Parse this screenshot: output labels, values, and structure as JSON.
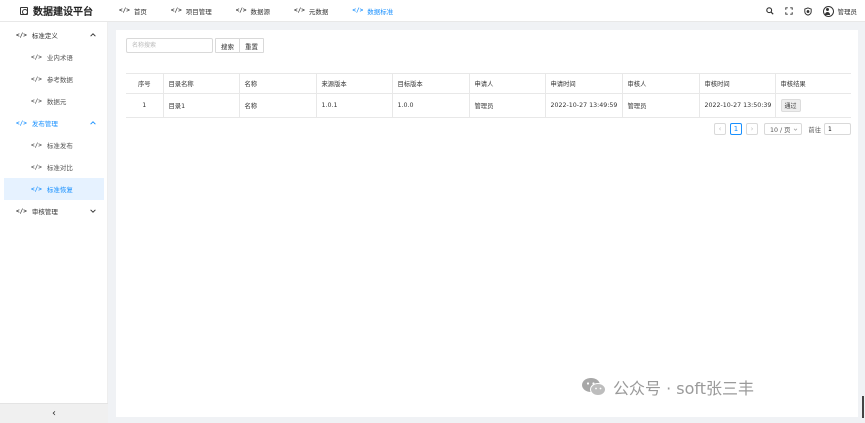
{
  "app": {
    "title": "数据建设平台"
  },
  "nav": {
    "code_glyph": "</>",
    "items": [
      {
        "label": "首页"
      },
      {
        "label": "项目管理"
      },
      {
        "label": "数据源"
      },
      {
        "label": "元数据"
      },
      {
        "label": "数据标准",
        "active": true
      }
    ]
  },
  "header": {
    "username": "管理员"
  },
  "sidebar": {
    "groups": [
      {
        "label": "标准定义",
        "items": [
          "业内术语",
          "参考数据",
          "数据元"
        ]
      },
      {
        "label": "发布管理",
        "items": [
          "标准发布",
          "标准对比",
          "标准恢复"
        ],
        "selected": "标准恢复"
      },
      {
        "label": "审核管理",
        "items": []
      }
    ],
    "collapse_glyph": "‹"
  },
  "search": {
    "placeholder": "名称搜索",
    "value": "",
    "search_label": "搜索",
    "reset_label": "重置"
  },
  "table": {
    "headers": [
      "序号",
      "目录名称",
      "名称",
      "来源版本",
      "目标版本",
      "申请人",
      "申请时间",
      "审核人",
      "审核时间",
      "审核结果"
    ],
    "rows": [
      [
        "1",
        "目录1",
        "名称",
        "1.0.1",
        "1.0.0",
        "管理员",
        "2022-10-27 13:49:59",
        "管理员",
        "2022-10-27 13:50:39",
        "通过"
      ]
    ]
  },
  "pagination": {
    "prev": "‹",
    "current": "1",
    "next": "›",
    "page_size": "10 / 页",
    "jump_label": "前往",
    "jump_value": "1"
  },
  "watermark": {
    "text": "公众号 · soft张三丰"
  },
  "colors": {
    "accent": "#1890ff",
    "selected_bg": "#e6f2ff"
  }
}
